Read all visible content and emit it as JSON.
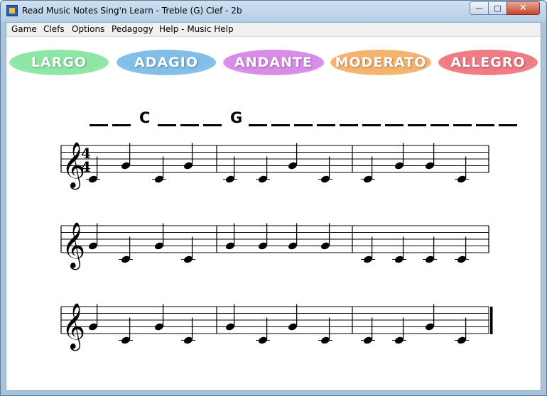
{
  "window": {
    "title": "Read Music Notes Sing'n Learn - Treble (G) Clef - 2b",
    "controls": {
      "minimize": "—",
      "maximize": "□",
      "close": "✕"
    }
  },
  "menu": [
    {
      "label": "Game"
    },
    {
      "label": "Clefs"
    },
    {
      "label": "Options"
    },
    {
      "label": "Pedagogy"
    },
    {
      "label": "Help - Music Help"
    }
  ],
  "tempos": [
    {
      "label": "LARGO",
      "color": "#8ee6a6"
    },
    {
      "label": "ADAGIO",
      "color": "#82bfe8"
    },
    {
      "label": "ANDANTE",
      "color": "#d98be8"
    },
    {
      "label": "MODERATO",
      "color": "#f4b46e"
    },
    {
      "label": "ALLEGRO",
      "color": "#ef7b84"
    }
  ],
  "answer": {
    "slots": [
      "",
      "",
      "C",
      "",
      "",
      "",
      "G",
      "",
      "",
      "",
      "",
      "",
      "",
      "",
      "",
      "",
      "",
      "",
      ""
    ]
  },
  "music": {
    "clef": "treble",
    "time_signature": {
      "numerator": "4",
      "denominator": "4"
    },
    "note_step_legend": "0 = middle C (ledger line), 2 = E (bottom line), 4 = G, 6 = B",
    "systems": [
      {
        "measures": [
          [
            "C",
            "G",
            "C",
            "G"
          ],
          [
            "C",
            "C",
            "G",
            "C"
          ],
          [
            "C",
            "G",
            "G",
            "C"
          ]
        ]
      },
      {
        "measures": [
          [
            "G",
            "C",
            "G",
            "C"
          ],
          [
            "G",
            "G",
            "G",
            "G"
          ],
          [
            "C",
            "C",
            "C",
            "C"
          ]
        ]
      },
      {
        "measures": [
          [
            "G",
            "C",
            "G",
            "C"
          ],
          [
            "G",
            "C",
            "G",
            "C"
          ],
          [
            "C",
            "C",
            "G",
            "C"
          ]
        ]
      }
    ]
  }
}
